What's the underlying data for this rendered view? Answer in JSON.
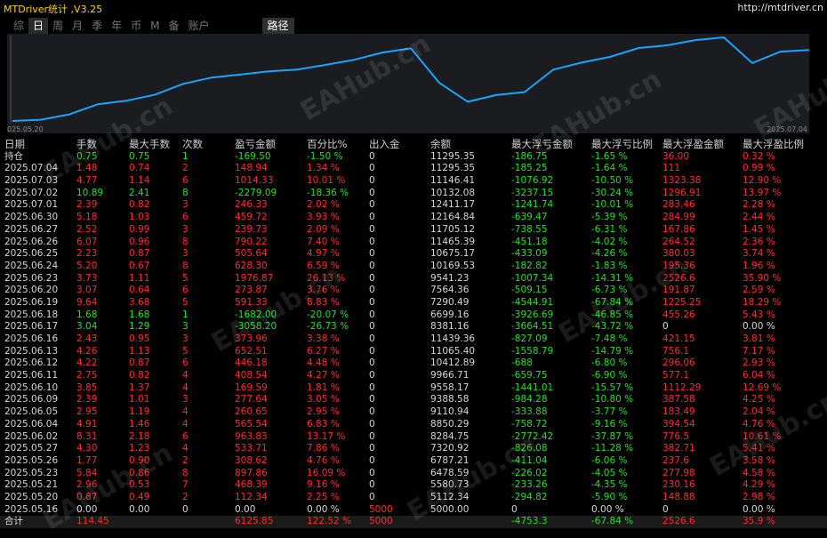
{
  "app": {
    "title": "MTDriver统计 ,V3.25",
    "url": "http://mtdriver.cn"
  },
  "tabs": [
    "综",
    "日",
    "周",
    "月",
    "季",
    "年",
    "币",
    "M",
    "备",
    "账户"
  ],
  "active_tab": "日",
  "path_tab": "路径",
  "chart": {
    "start_date": "025.05.20",
    "end_date": "2025.07.04",
    "line_color": "#1aa3ff"
  },
  "headers": [
    "日期",
    "手数",
    "最大手数",
    "次数",
    "盈亏金额",
    "百分比%",
    "出入金",
    "余额",
    "最大浮亏金额",
    "最大浮亏比例",
    "最大浮盈金额",
    "最大浮盈比例"
  ],
  "rows": [
    [
      "持仓",
      "0.75",
      "0.75",
      "1",
      "-169.50",
      "-1.50 %",
      "0",
      "11295.35",
      "-186.75",
      "-1.65 %",
      "36.00",
      "0.32 %"
    ],
    [
      "2025.07.04",
      "1.48",
      "0.74",
      "2",
      "148.94",
      "1.34 %",
      "0",
      "11295.35",
      "-185.25",
      "-1.64 %",
      "111",
      "0.99 %"
    ],
    [
      "2025.07.03",
      "4.77",
      "1.14",
      "6",
      "1014.33",
      "10.01 %",
      "0",
      "11146.41",
      "-1076.92",
      "-10.50 %",
      "1323.38",
      "12.90 %"
    ],
    [
      "2025.07.02",
      "10.89",
      "2.41",
      "8",
      "-2279.09",
      "-18.36 %",
      "0",
      "10132.08",
      "-3237.15",
      "-30.24 %",
      "1296.91",
      "13.97 %"
    ],
    [
      "2025.07.01",
      "2.39",
      "0.82",
      "3",
      "246.33",
      "2.02 %",
      "0",
      "12411.17",
      "-1241.74",
      "-10.01 %",
      "283.46",
      "2.28 %"
    ],
    [
      "2025.06.30",
      "5.18",
      "1.03",
      "6",
      "459.72",
      "3.93 %",
      "0",
      "12164.84",
      "-639.47",
      "-5.39 %",
      "284.99",
      "2.44 %"
    ],
    [
      "2025.06.27",
      "2.52",
      "0.99",
      "3",
      "239.73",
      "2.09 %",
      "0",
      "11705.12",
      "-738.55",
      "-6.31 %",
      "167.86",
      "1.45 %"
    ],
    [
      "2025.06.26",
      "6.07",
      "0.96",
      "8",
      "790.22",
      "7.40 %",
      "0",
      "11465.39",
      "-451.18",
      "-4.02 %",
      "264.52",
      "2.36 %"
    ],
    [
      "2025.06.25",
      "2.23",
      "0.87",
      "3",
      "505.64",
      "4.97 %",
      "0",
      "10675.17",
      "-433.09",
      "-4.26 %",
      "380.03",
      "3.74 %"
    ],
    [
      "2025.06.24",
      "5.20",
      "0.67",
      "8",
      "628.30",
      "6.59 %",
      "0",
      "10169.53",
      "-182.82",
      "-1.83 %",
      "195.36",
      "1.96 %"
    ],
    [
      "2025.06.23",
      "3.73",
      "1.11",
      "5",
      "1976.87",
      "26.13 %",
      "0",
      "9541.23",
      "-1007.34",
      "-14.31 %",
      "2526.6",
      "35.90 %"
    ],
    [
      "2025.06.20",
      "3.07",
      "0.64",
      "6",
      "273.87",
      "3.76 %",
      "0",
      "7564.36",
      "-509.15",
      "-6.73 %",
      "191.87",
      "2.59 %"
    ],
    [
      "2025.06.19",
      "9.64",
      "3.68",
      "5",
      "591.33",
      "8.83 %",
      "0",
      "7290.49",
      "-4544.91",
      "-67.84 %",
      "1225.25",
      "18.29 %"
    ],
    [
      "2025.06.18",
      "1.68",
      "1.68",
      "1",
      "-1682.00",
      "-20.07 %",
      "0",
      "6699.16",
      "-3926.69",
      "-46.85 %",
      "455.26",
      "5.43 %"
    ],
    [
      "2025.06.17",
      "3.04",
      "1.29",
      "3",
      "-3058.20",
      "-26.73 %",
      "0",
      "8381.16",
      "-3664.51",
      "-43.72 %",
      "0",
      "0.00 %"
    ],
    [
      "2025.06.16",
      "2.43",
      "0.95",
      "3",
      "373.96",
      "3.38 %",
      "0",
      "11439.36",
      "-827.09",
      "-7.48 %",
      "421.15",
      "3.81 %"
    ],
    [
      "2025.06.13",
      "4.26",
      "1.13",
      "5",
      "652.51",
      "6.27 %",
      "0",
      "11065.40",
      "-1558.79",
      "-14.79 %",
      "756.1",
      "7.17 %"
    ],
    [
      "2025.06.12",
      "4.22",
      "0.87",
      "6",
      "446.18",
      "4.48 %",
      "0",
      "10412.89",
      "-688",
      "-6.80 %",
      "296.06",
      "2.93 %"
    ],
    [
      "2025.06.11",
      "2.75",
      "0.82",
      "4",
      "408.54",
      "4.27 %",
      "0",
      "9966.71",
      "-659.75",
      "-6.90 %",
      "577.1",
      "6.04 %"
    ],
    [
      "2025.06.10",
      "3.85",
      "1.37",
      "4",
      "169.59",
      "1.81 %",
      "0",
      "9558.17",
      "-1441.01",
      "-15.57 %",
      "1112.29",
      "12.69 %"
    ],
    [
      "2025.06.09",
      "2.39",
      "1.01",
      "3",
      "277.64",
      "3.05 %",
      "0",
      "9388.58",
      "-984.28",
      "-10.80 %",
      "387.58",
      "4.25 %"
    ],
    [
      "2025.06.05",
      "2.95",
      "1.19",
      "4",
      "260.65",
      "2.95 %",
      "0",
      "9110.94",
      "-333.88",
      "-3.77 %",
      "183.49",
      "2.04 %"
    ],
    [
      "2025.06.04",
      "4.91",
      "1.46",
      "4",
      "565.54",
      "6.83 %",
      "0",
      "8850.29",
      "-758.72",
      "-9.16 %",
      "394.54",
      "4.76 %"
    ],
    [
      "2025.06.02",
      "8.31",
      "2.18",
      "6",
      "963.83",
      "13.17 %",
      "0",
      "8284.75",
      "-2772.42",
      "-37.87 %",
      "776.5",
      "10.61 %"
    ],
    [
      "2025.05.27",
      "4.30",
      "1.23",
      "4",
      "533.71",
      "7.86 %",
      "0",
      "7320.92",
      "-826.08",
      "-11.28 %",
      "382.71",
      "5.41 %"
    ],
    [
      "2025.05.26",
      "1.77",
      "0.90",
      "2",
      "308.62",
      "4.76 %",
      "0",
      "6787.21",
      "-411.04",
      "-6.06 %",
      "237.6",
      "3.58 %"
    ],
    [
      "2025.05.23",
      "5.84",
      "0.86",
      "8",
      "897.86",
      "16.09 %",
      "0",
      "6478.59",
      "-226.02",
      "-4.05 %",
      "277.98",
      "4.58 %"
    ],
    [
      "2025.05.21",
      "2.96",
      "0.53",
      "7",
      "468.39",
      "9.16 %",
      "0",
      "5580.73",
      "-233.26",
      "-4.35 %",
      "230.16",
      "4.29 %"
    ],
    [
      "2025.05.20",
      "0.87",
      "0.49",
      "2",
      "112.34",
      "2.25 %",
      "0",
      "5112.34",
      "-294.82",
      "-5.90 %",
      "148.88",
      "2.98 %"
    ],
    [
      "2025.05.16",
      "0.00",
      "0.00",
      "0",
      "0.00",
      "0.00 %",
      "5000",
      "5000.00",
      "0",
      "0.00 %",
      "0",
      "0.00 %"
    ]
  ],
  "total": [
    "合计",
    "114.45",
    "",
    "",
    "6125.85",
    "122.52 %",
    "5000",
    "",
    "-4753.3",
    "-67.84 %",
    "2526.6",
    "35.9 %"
  ],
  "watermark": "EAHub.cn"
}
